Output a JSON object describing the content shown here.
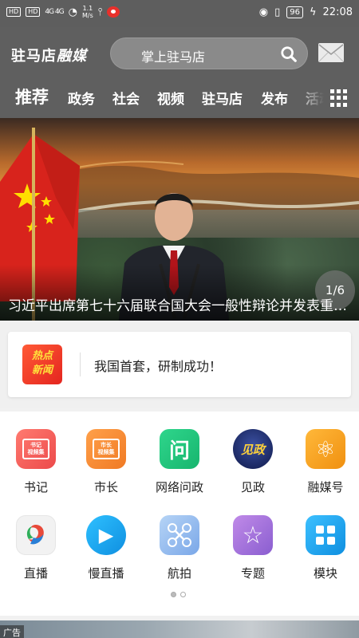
{
  "status_bar": {
    "sim1": "HD",
    "sim2": "HD",
    "signal": "4G 4G",
    "speed": "1.1\nM/s",
    "battery": "96",
    "time": "22:08"
  },
  "header": {
    "logo_text": "驻马店",
    "logo_script": "融媒",
    "search_placeholder": "掌上驻马店"
  },
  "tabs": [
    "推荐",
    "政务",
    "社会",
    "视频",
    "驻马店",
    "发布",
    "活动"
  ],
  "banner": {
    "title": "习近平出席第七十六届联合国大会一般性辩论并发表重要讲话",
    "page": "1/6"
  },
  "hot_news": {
    "badge": "热点\n新闻",
    "text": "我国首套，研制成功！"
  },
  "grid_items": [
    {
      "label": "书记",
      "icon": "video-collection-icon",
      "color": "#f2625e",
      "glyph": "书记\n视频集"
    },
    {
      "label": "市长",
      "icon": "video-collection-icon",
      "color": "#f28a33",
      "glyph": "市长\n视频集"
    },
    {
      "label": "网络问政",
      "icon": "question-icon",
      "color": "#20c07a",
      "glyph": "问"
    },
    {
      "label": "见政",
      "icon": "jianzheng-logo-icon",
      "color": "#1a2a6a",
      "glyph": "见政"
    },
    {
      "label": "融媒号",
      "icon": "atom-icon",
      "color": "#f6a31a",
      "glyph": "⚛"
    },
    {
      "label": "直播",
      "icon": "live-logo-icon",
      "color": "#f4f4f4",
      "glyph": ""
    },
    {
      "label": "慢直播",
      "icon": "play-icon",
      "color": "#1fa9ef",
      "glyph": "▶"
    },
    {
      "label": "航拍",
      "icon": "drone-icon",
      "color": "#8fb8ee",
      "glyph": "✕"
    },
    {
      "label": "专题",
      "icon": "star-icon",
      "color": "#a97ad8",
      "glyph": "☆"
    },
    {
      "label": "模块",
      "icon": "modules-icon",
      "color": "#1ba6ea",
      "glyph": "▦"
    }
  ],
  "ad": {
    "label": "广告"
  }
}
